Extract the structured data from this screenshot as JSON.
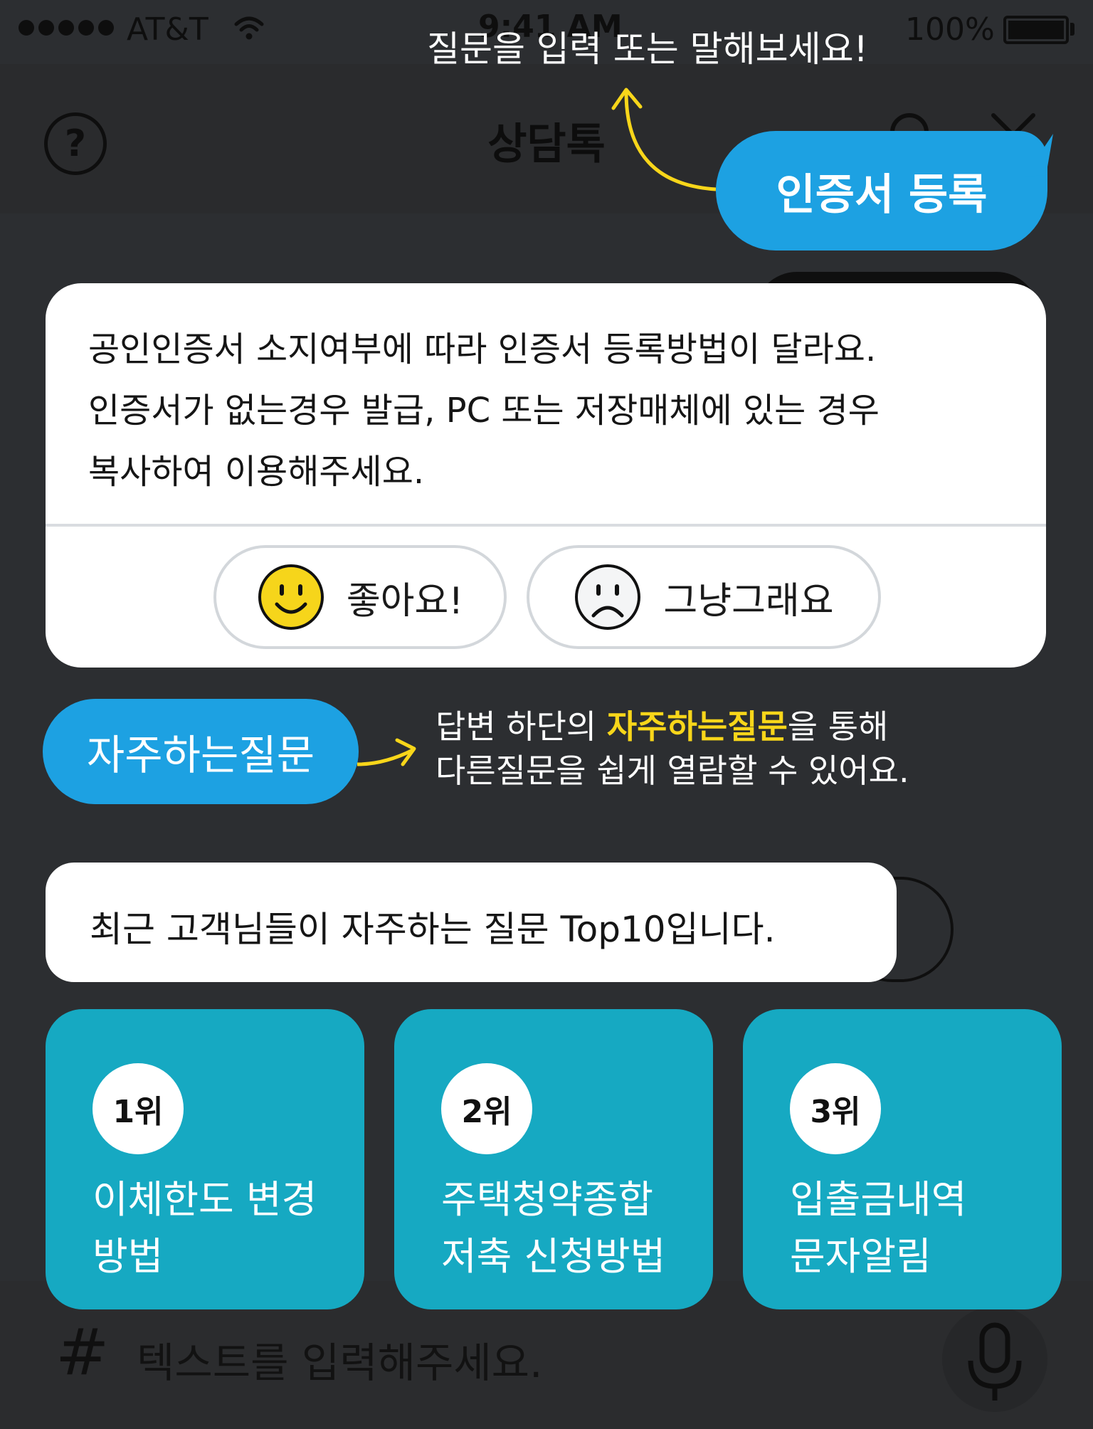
{
  "status_bar": {
    "carrier": "AT&T",
    "time": "9:41 AM",
    "battery": "100%"
  },
  "navbar": {
    "title": "상담톡",
    "help_glyph": "?"
  },
  "input_bar": {
    "hash": "#",
    "placeholder": "텍스트를 입력해주세요."
  },
  "hints": {
    "top": "질문을 입력 또는 말해보세요!",
    "faq_line1_before": "답변 하단의 ",
    "faq_line1_highlight": "자주하는질문",
    "faq_line1_after": "을 통해",
    "faq_line2": "다른질문을 쉽게 열람할 수 있어요."
  },
  "user_bubble": "인증서 등록",
  "faq_bubble": "자주하는질문",
  "answer": {
    "line1": "공인인증서 소지여부에 따라 인증서 등록방법이 달라요.",
    "line2": "인증서가 없는경우 발급, PC 또는 저장매체에 있는 경우",
    "line3": "복사하여 이용해주세요.",
    "like_label": "좋아요!",
    "meh_label": "그냥그래요"
  },
  "faq_intro": "최근 고객님들이 자주하는 질문 Top10입니다.",
  "top_questions": [
    {
      "rank": "1위",
      "line1": "이체한도 변경",
      "line2": "방법"
    },
    {
      "rank": "2위",
      "line1": "주택청약종합",
      "line2": "저축 신청방법"
    },
    {
      "rank": "3위",
      "line1": "입출금내역",
      "line2": "문자알림"
    }
  ],
  "colors": {
    "accent_blue": "#1da1e2",
    "card_teal": "#16a9c2",
    "highlight_yellow": "#f8d61a",
    "overlay": "#2c2e31"
  },
  "icons": [
    "wifi-icon",
    "battery-icon",
    "help-icon",
    "person-icon",
    "close-icon",
    "smile-icon",
    "frown-icon",
    "mic-icon",
    "arrow-icon"
  ]
}
